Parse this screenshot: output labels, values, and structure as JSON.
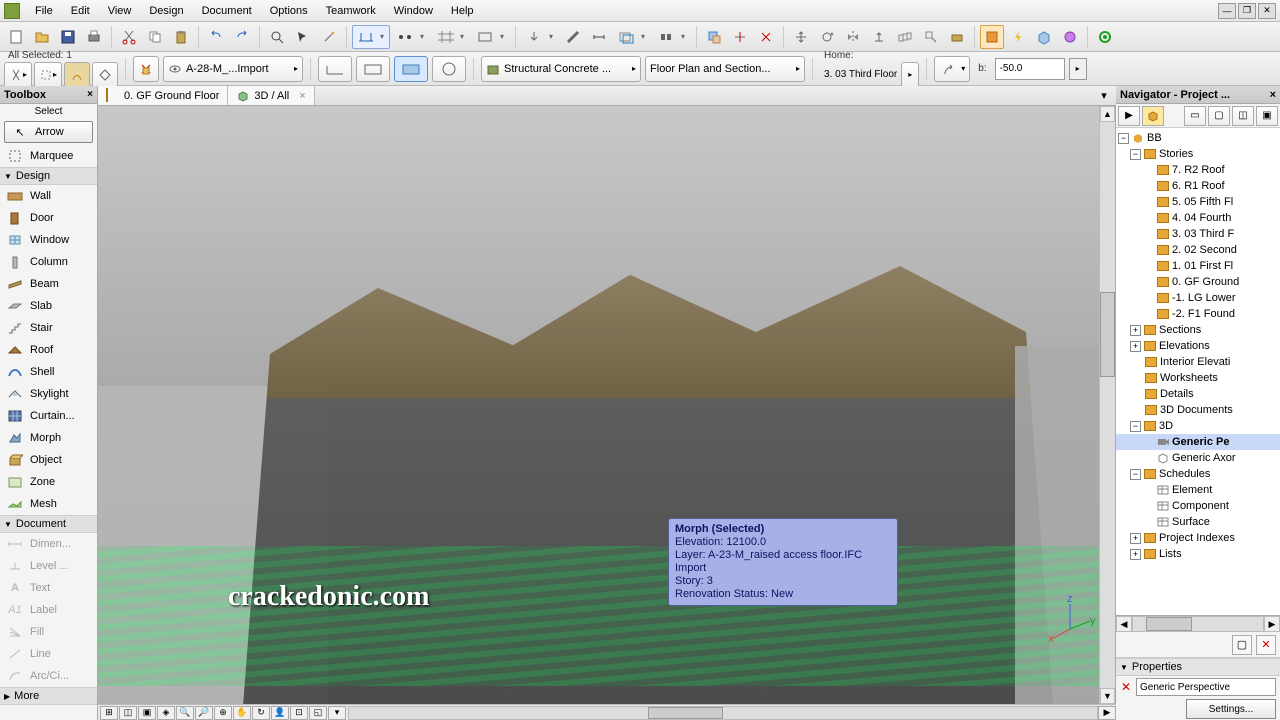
{
  "menu": {
    "items": [
      "File",
      "Edit",
      "View",
      "Design",
      "Document",
      "Options",
      "Teamwork",
      "Window",
      "Help"
    ]
  },
  "infobox": {
    "all_selected": "All Selected: 1",
    "layer_dropdown": "A-28-M_...Import",
    "material_dropdown": "Structural Concrete ...",
    "plan_type_dropdown": "Floor Plan and Section...",
    "home_label": "Home:",
    "home_story": "3. 03 Third Floor",
    "b_label": "b:",
    "b_value": "-50.0"
  },
  "toolbox": {
    "title": "Toolbox",
    "select_label": "Select",
    "arrow": "Arrow",
    "marquee": "Marquee",
    "design_group": "Design",
    "document_group": "Document",
    "more_group": "More",
    "tools": [
      "Wall",
      "Door",
      "Window",
      "Column",
      "Beam",
      "Slab",
      "Stair",
      "Roof",
      "Shell",
      "Skylight",
      "Curtain...",
      "Morph",
      "Object",
      "Zone",
      "Mesh"
    ],
    "doc_tools": [
      "Dimen...",
      "Level ...",
      "Text",
      "Label",
      "Fill",
      "Line",
      "Arc/Ci..."
    ]
  },
  "tabs": {
    "tab1": "0. GF Ground Floor",
    "tab2": "3D / All"
  },
  "tooltip": {
    "title": "Morph (Selected)",
    "line1": "Elevation: 12100.0",
    "line2": "Layer: A-23-M_raised access floor.IFC Import",
    "line3": "Story: 3",
    "line4": "Renovation Status: New"
  },
  "watermark": "crackedonic.com",
  "navigator": {
    "title": "Navigator - Project ...",
    "root": "BB",
    "stories_label": "Stories",
    "stories": [
      "7. R2 Roof",
      "6. R1 Roof",
      "5. 05 Fifth Fl",
      "4. 04 Fourth",
      "3. 03 Third F",
      "2. 02 Second",
      "1. 01 First Fl",
      "0. GF Ground",
      "-1. LG Lower",
      "-2. F1 Found"
    ],
    "sections": "Sections",
    "elevations": "Elevations",
    "interior": "Interior Elevati",
    "worksheets": "Worksheets",
    "details": "Details",
    "docs3d": "3D Documents",
    "td_label": "3D",
    "generic_pe": "Generic Pe",
    "generic_axo": "Generic Axor",
    "schedules": "Schedules",
    "sched_items": [
      "Element",
      "Component",
      "Surface"
    ],
    "proj_idx": "Project Indexes",
    "lists": "Lists"
  },
  "properties": {
    "title": "Properties",
    "persp": "Generic Perspective",
    "settings": "Settings..."
  }
}
